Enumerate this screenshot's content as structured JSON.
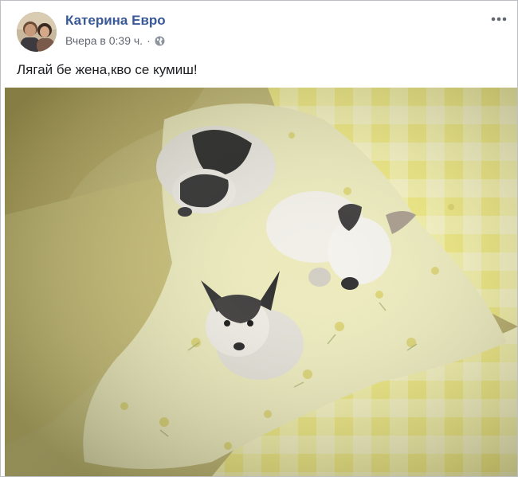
{
  "post": {
    "author": "Катерина Евро",
    "timestamp": "Вчера в 0:39 ч.",
    "separator": "·",
    "audience_icon": "globe-icon",
    "menu_icon": "more-options-icon",
    "caption": "Лягай бе жена,кво се кумиш!"
  },
  "photo": {
    "subject": "three dogs lying on a bed with yellow floral bedding"
  },
  "colors": {
    "author_link": "#385898",
    "meta_text": "#616770",
    "body_text": "#1c1e21",
    "border": "#bcc0c4"
  }
}
